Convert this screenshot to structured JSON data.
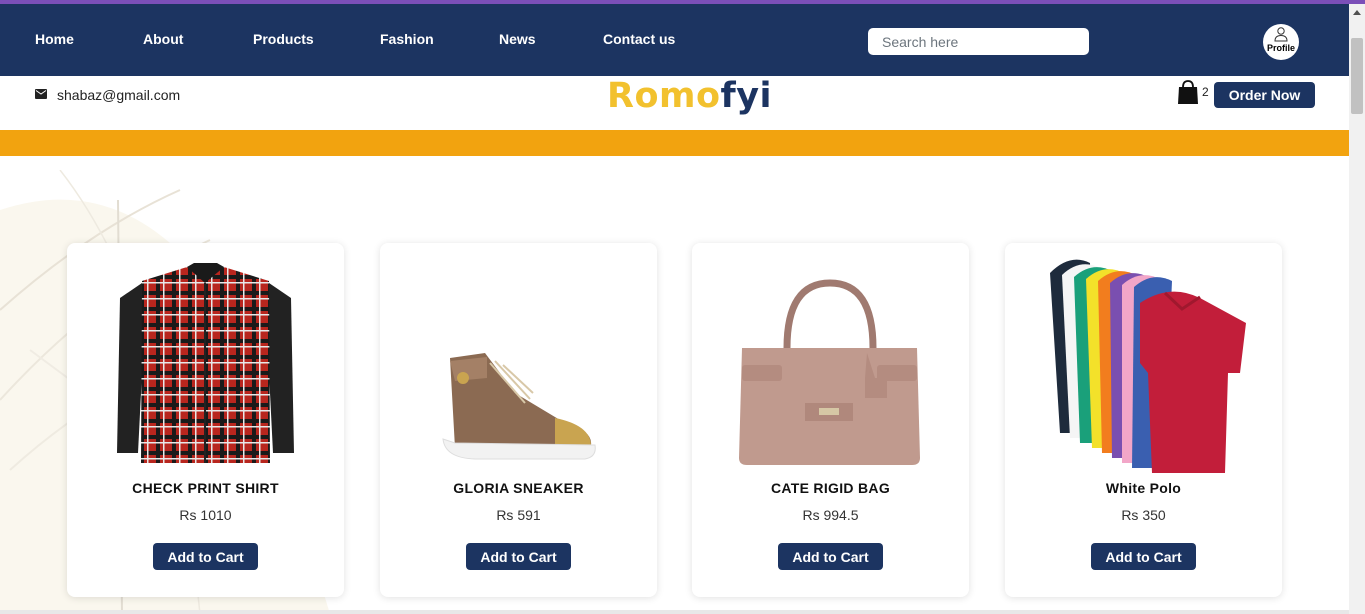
{
  "nav": {
    "links": [
      "Home",
      "About",
      "Products",
      "Fashion",
      "News",
      "Contact us"
    ],
    "search_placeholder": "Search here",
    "profile_label": "Profile"
  },
  "header": {
    "email": "shabaz@gmail.com",
    "logo_part1": "Romo",
    "logo_part2": "fyi",
    "cart_count": "2",
    "order_button": "Order Now"
  },
  "colors": {
    "navy": "#1c3461",
    "orange_stripe": "#f2a30f",
    "logo_yellow": "#f2c12e"
  },
  "products": [
    {
      "name": "CHECK PRINT SHIRT",
      "price": "Rs 1010",
      "button": "Add to Cart"
    },
    {
      "name": "GLORIA SNEAKER",
      "price": "Rs 591",
      "button": "Add to Cart"
    },
    {
      "name": "CATE RIGID BAG",
      "price": "Rs 994.5",
      "button": "Add to Cart"
    },
    {
      "name": "White Polo",
      "price": "Rs 350",
      "button": "Add to Cart"
    }
  ]
}
